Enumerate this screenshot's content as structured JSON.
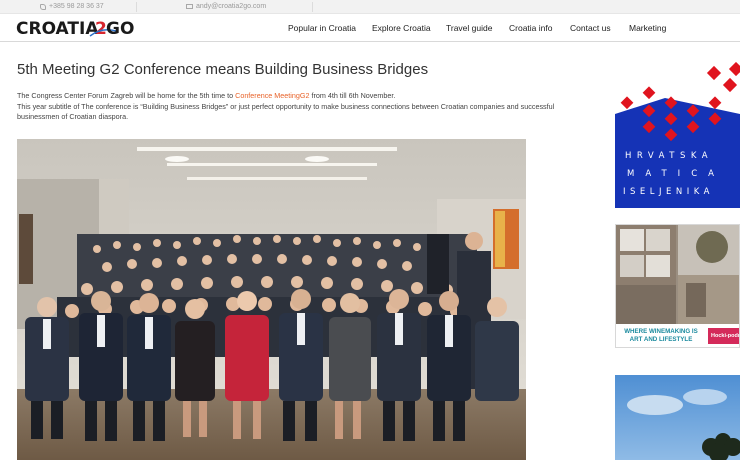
{
  "topbar": {
    "phone": "+385 98 28 36 37",
    "email": "andy@croatia2go.com"
  },
  "brand": {
    "logo_left": "CROATIA",
    "logo_num": "2",
    "logo_right": "GO"
  },
  "nav": {
    "items": [
      {
        "label": "Popular in Croatia"
      },
      {
        "label": "Explore Croatia"
      },
      {
        "label": "Travel guide"
      },
      {
        "label": "Croatia info"
      },
      {
        "label": "Contact us"
      },
      {
        "label": "Marketing"
      }
    ]
  },
  "article": {
    "title": "5th Meeting G2 Conference means Building Business Bridges",
    "p1_before": "The Congress Center Forum Zagreb will be home for the 5th time to ",
    "p1_link": "Conference MeetingG2",
    "p1_after": "  from 4th till 6th November.",
    "p2": "This year subtitle of The conference is “Building Business Bridges” or just perfect opportunity to make business connections between Croatian companies and successful businessmen of Croatian diaspora."
  },
  "sidebar": {
    "ad1_lines": [
      "HRVATSKA",
      "MATICA",
      "ISELJENIKA"
    ],
    "ad2_caption_1": "WHERE WINEMAKING IS",
    "ad2_caption_2": "ART AND LIFESTYLE",
    "ad2_tag": "Hocki-podr"
  },
  "colors": {
    "accent_link": "#e8632a",
    "ad1_blue": "#1533b6",
    "ad1_red": "#e0141e",
    "ad2_teal": "#1b8a9e",
    "ad2_tag": "#d42a5a"
  }
}
